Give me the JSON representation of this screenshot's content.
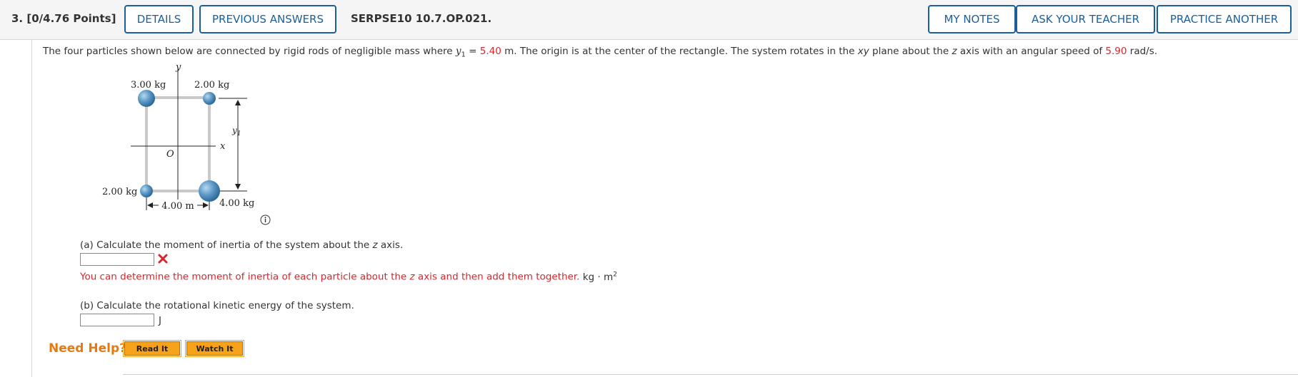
{
  "header": {
    "question_number": "3. [0/4.76 Points]",
    "details_label": "DETAILS",
    "previous_answers_label": "PREVIOUS ANSWERS",
    "question_id": "SERPSE10 10.7.OP.021.",
    "my_notes_label": "MY NOTES",
    "ask_teacher_label": "ASK YOUR TEACHER",
    "practice_another_label": "PRACTICE ANOTHER"
  },
  "problem": {
    "text_1": "The four particles shown below are connected by rigid rods of negligible mass where ",
    "var_y": "y",
    "sub_1": "1",
    "text_2": " = ",
    "y1_value": "5.40",
    "text_3": " m. The origin is at the center of the rectangle. The system rotates in the ",
    "var_xy": "xy",
    "text_4": " plane about the ",
    "var_z": "z",
    "text_5": " axis with an angular speed of ",
    "omega_value": "5.90",
    "text_6": " rad/s."
  },
  "figure": {
    "mass_top_left": "3.00 kg",
    "mass_top_right": "2.00 kg",
    "mass_bottom_left": "2.00 kg",
    "mass_bottom_right": "4.00 kg",
    "y_axis_label": "y",
    "x_axis_label": "x",
    "origin_label": "O",
    "y1_label": "y",
    "y1_sub": "1",
    "width_label": "4.00 m",
    "info_icon": "info-icon"
  },
  "part_a": {
    "prompt_pre": "(a) Calculate the moment of inertia of the system about the ",
    "prompt_var": "z",
    "prompt_post": " axis.",
    "answer_value": "",
    "hint_pre": "You can determine the moment of inertia of each particle about the ",
    "hint_var": "z",
    "hint_post": " axis and then add them together.",
    "unit": "kg · m",
    "unit_exp": "2",
    "status_icon": "incorrect-x-icon"
  },
  "part_b": {
    "prompt": "(b) Calculate the rotational kinetic energy of the system.",
    "answer_value": "",
    "unit": "J"
  },
  "help": {
    "need_help_label": "Need Help?",
    "read_it_label": "Read It",
    "watch_it_label": "Watch It"
  },
  "colors": {
    "accent_blue": "#1a5e9a",
    "error_red": "#d9262b",
    "help_orange": "#e37a12",
    "help_button": "#f7a21b"
  }
}
